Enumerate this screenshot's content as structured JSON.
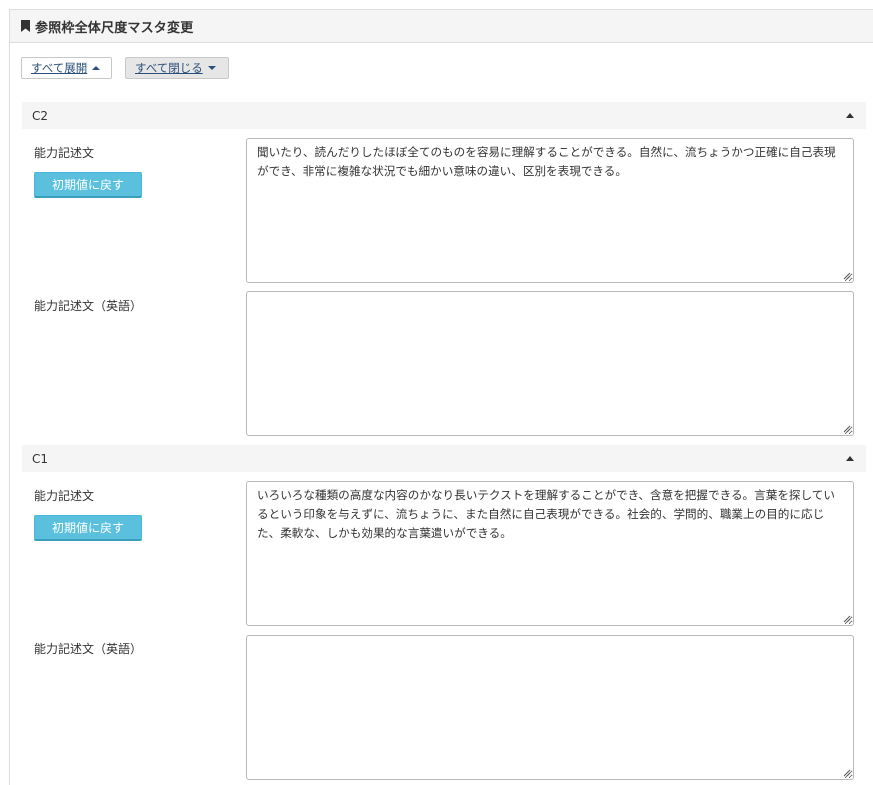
{
  "panel": {
    "title": "参照枠全体尺度マスタ変更"
  },
  "toolbar": {
    "expand_all": "すべて展開",
    "collapse_all": "すべて閉じる"
  },
  "sections": [
    {
      "code": "C2",
      "descriptor_label": "能力記述文",
      "reset_label": "初期値に戻す",
      "descriptor_value": "聞いたり、読んだりしたほぼ全てのものを容易に理解することができる。自然に、流ちょうかつ正確に自己表現ができ、非常に複雑な状況でも細かい意味の違い、区別を表現できる。",
      "descriptor_en_label": "能力記述文（英語）",
      "descriptor_en_value": ""
    },
    {
      "code": "C1",
      "descriptor_label": "能力記述文",
      "reset_label": "初期値に戻す",
      "descriptor_value": "いろいろな種類の高度な内容のかなり長いテクストを理解することができ、含意を把握できる。言葉を探しているという印象を与えずに、流ちょうに、また自然に自己表現ができる。社会的、学問的、職業上の目的に応じた、柔軟な、しかも効果的な言葉遣いができる。",
      "descriptor_en_label": "能力記述文（英語）",
      "descriptor_en_value": ""
    }
  ]
}
